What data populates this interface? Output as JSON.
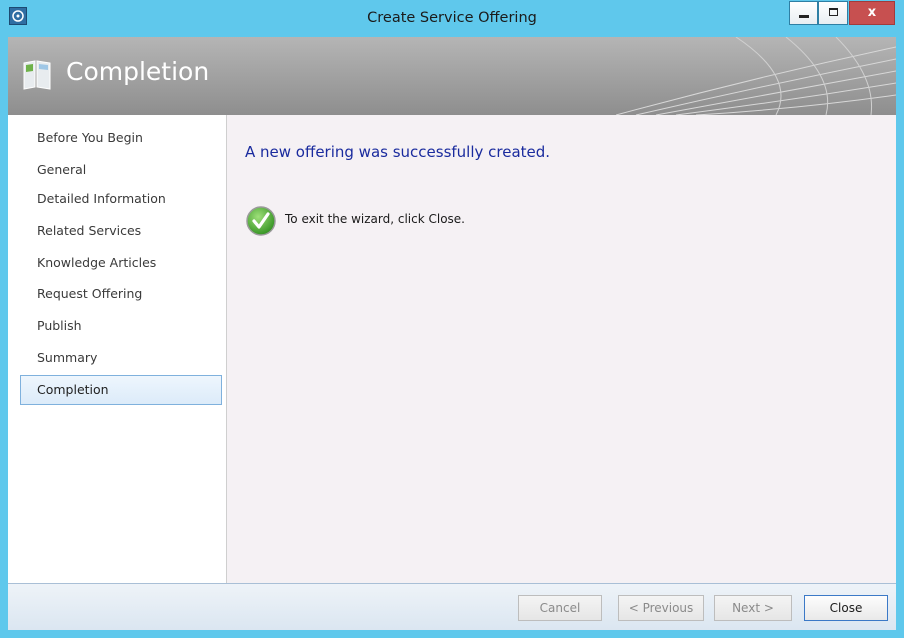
{
  "window": {
    "title": "Create Service Offering",
    "close_glyph": "x"
  },
  "header": {
    "title": "Completion",
    "icon": "book-icon"
  },
  "sidebar": {
    "items": [
      {
        "label": "Before You Begin"
      },
      {
        "label": "General"
      },
      {
        "label": "Detailed Information"
      },
      {
        "label": "Related Services"
      },
      {
        "label": "Knowledge Articles"
      },
      {
        "label": "Request Offering"
      },
      {
        "label": "Publish"
      },
      {
        "label": "Summary"
      },
      {
        "label": "Completion",
        "selected": true
      }
    ]
  },
  "main": {
    "heading": "A new offering was successfully created.",
    "instruction": "To exit the wizard, click Close.",
    "status_icon": "success-check-icon"
  },
  "footer": {
    "cancel_label": "Cancel",
    "previous_label": "< Previous",
    "next_label": "Next >",
    "close_label": "Close"
  },
  "colors": {
    "titlebar": "#5fc8ec",
    "heading": "#1a2b9e",
    "selection_border": "#7fb1dd",
    "close_button": "#c75050"
  }
}
